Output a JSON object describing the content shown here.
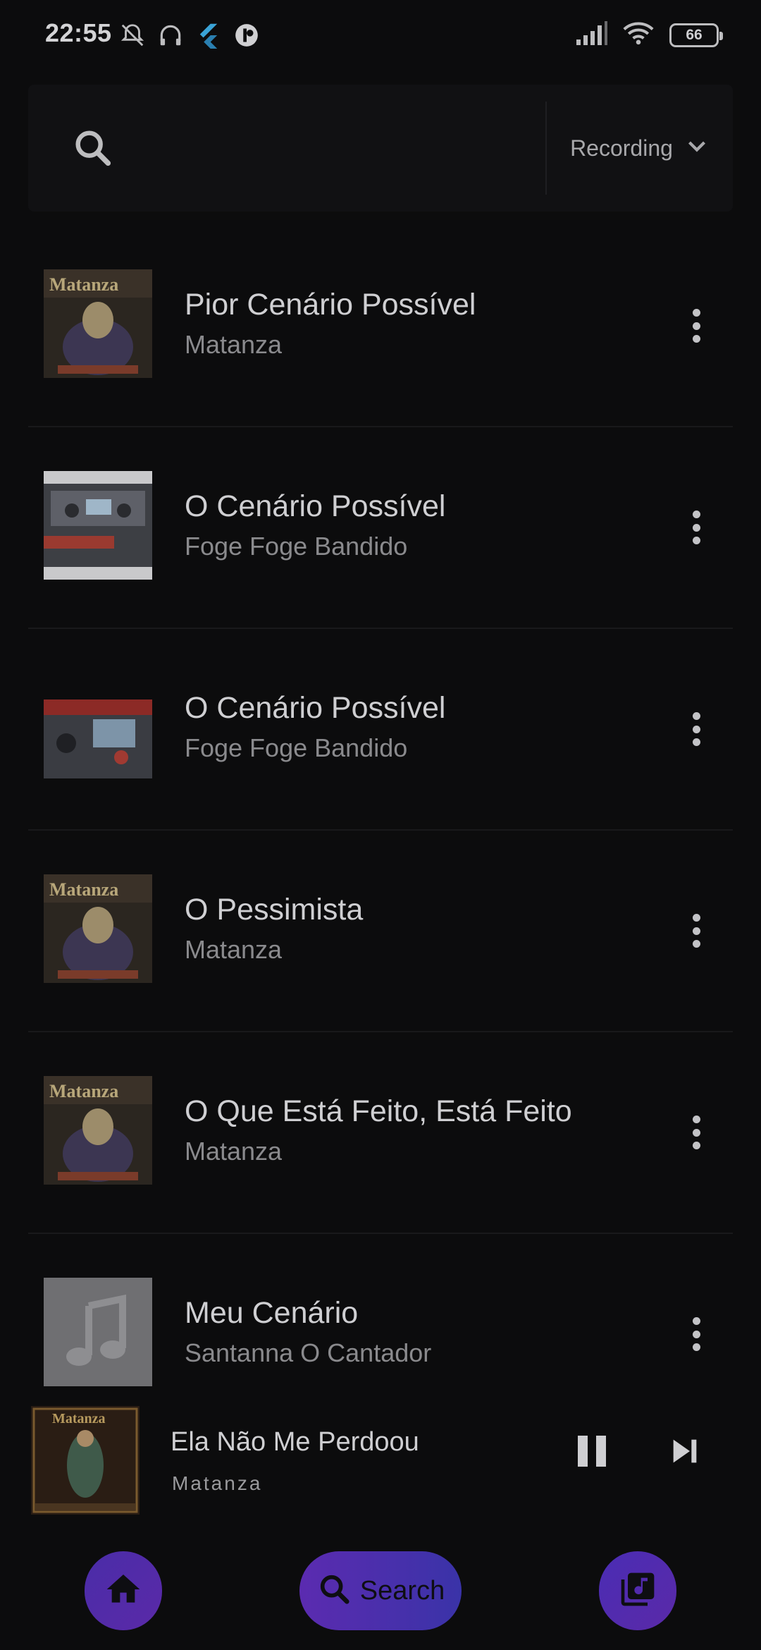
{
  "status_bar": {
    "time": "22:55",
    "battery": "66",
    "icons": [
      "mute-bell-icon",
      "headphones-icon",
      "flutter-icon",
      "app-icon",
      "signal-icon",
      "wifi-icon",
      "battery-icon"
    ]
  },
  "search": {
    "placeholder": "",
    "filter_label": "Recording"
  },
  "songs": [
    {
      "title": "Pior Cenário Possível",
      "artist": "Matanza",
      "art": "matanza"
    },
    {
      "title": "O Cenário Possível",
      "artist": "Foge Foge Bandido",
      "art": "cassette-grey"
    },
    {
      "title": "O Cenário Possível",
      "artist": "Foge Foge Bandido",
      "art": "cassette-red"
    },
    {
      "title": "O Pessimista",
      "artist": "Matanza",
      "art": "matanza"
    },
    {
      "title": "O Que Está Feito, Está Feito",
      "artist": "Matanza",
      "art": "matanza"
    },
    {
      "title": "Meu Cenário",
      "artist": "Santanna O Cantador",
      "art": "placeholder-note"
    }
  ],
  "now_playing": {
    "title": "Ela Não Me Perdoou",
    "artist": "Matanza"
  },
  "bottom_nav": {
    "search_label": "Search"
  },
  "colors": {
    "background": "#0c0c0d",
    "accent": "#5a2aa8"
  }
}
